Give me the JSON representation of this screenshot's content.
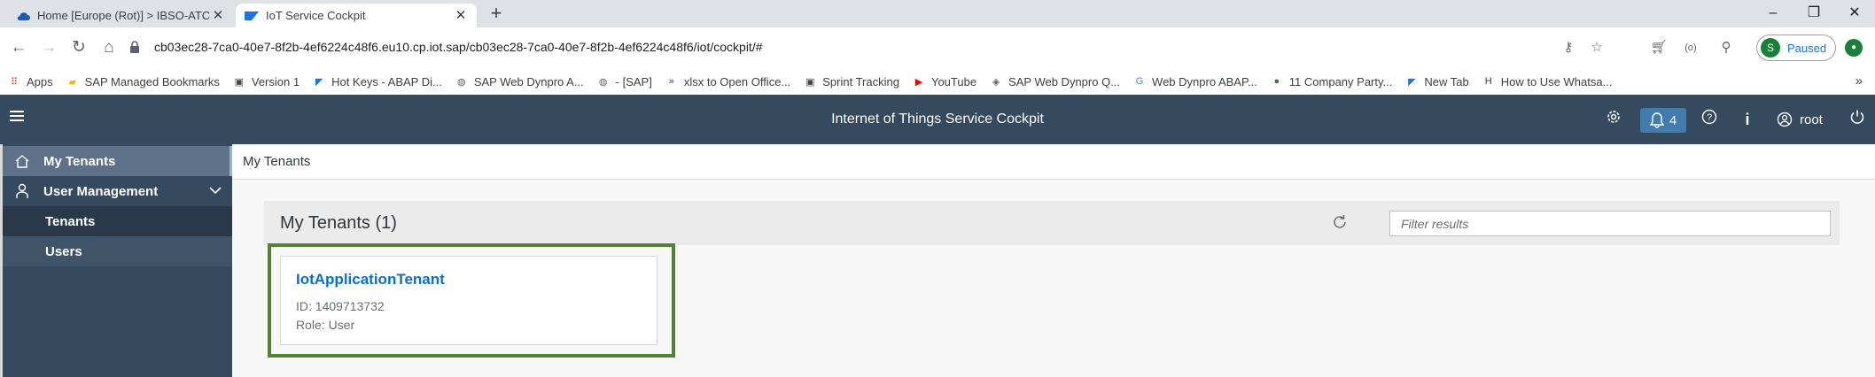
{
  "browser": {
    "tabs": [
      {
        "title": "Home [Europe (Rot)] > IBSO-ATC",
        "active": false
      },
      {
        "title": "IoT Service Cockpit",
        "active": true
      }
    ],
    "url": "cb03ec28-7ca0-40e7-8f2b-4ef6224c48f6.eu10.cp.iot.sap/cb03ec28-7ca0-40e7-8f2b-4ef6224c48f6/iot/cockpit/#",
    "profile_initial": "S",
    "profile_status": "Paused",
    "bookmarks": [
      {
        "label": "Apps",
        "icon": "apps-grid-icon",
        "color": "#d93025"
      },
      {
        "label": "SAP Managed Bookmarks",
        "icon": "folder-icon",
        "color": "#f2b600"
      },
      {
        "label": "Version 1",
        "icon": "slide-icon",
        "color": "#444444"
      },
      {
        "label": "Hot Keys - ABAP Di...",
        "icon": "sap-icon",
        "color": "#1a73e8"
      },
      {
        "label": "SAP Web Dynpro A...",
        "icon": "globe-icon",
        "color": "#5f6368"
      },
      {
        "label": "- [SAP]",
        "icon": "globe-icon",
        "color": "#5f6368"
      },
      {
        "label": "xlsx to Open Office...",
        "icon": "arrow-icon",
        "color": "#1f3c88"
      },
      {
        "label": "Sprint Tracking",
        "icon": "slide-icon",
        "color": "#444444"
      },
      {
        "label": "YouTube",
        "icon": "youtube-icon",
        "color": "#ff0000"
      },
      {
        "label": "SAP Web Dynpro Q...",
        "icon": "diamond-icon",
        "color": "#5f6368"
      },
      {
        "label": "Web Dynpro ABAP...",
        "icon": "google-icon",
        "color": "#4285f4"
      },
      {
        "label": "11 Company Party...",
        "icon": "badge-icon",
        "color": "#3a7d44"
      },
      {
        "label": "New Tab",
        "icon": "sap-icon",
        "color": "#1a73e8"
      },
      {
        "label": "How to Use Whatsa...",
        "icon": "htc-icon",
        "color": "#333333"
      }
    ],
    "more_bookmarks": "»"
  },
  "shell": {
    "title": "Internet of Things Service Cockpit",
    "notifications_count": "4",
    "info_label": "i",
    "user_name": "root"
  },
  "sidebar": {
    "items": [
      {
        "label": "My Tenants",
        "icon": "home-icon",
        "selected": true
      },
      {
        "label": "User Management",
        "icon": "person-icon",
        "expanded": true
      },
      {
        "label": "Tenants",
        "sub": true
      },
      {
        "label": "Users",
        "sub": true
      }
    ]
  },
  "main": {
    "breadcrumb": "My Tenants",
    "panel_title": "My Tenants (1)",
    "filter_placeholder": "Filter results",
    "tenant": {
      "name": "IotApplicationTenant",
      "id_line": "ID: 1409713732",
      "role_line": "Role: User"
    },
    "highlight_color": "#548235"
  }
}
